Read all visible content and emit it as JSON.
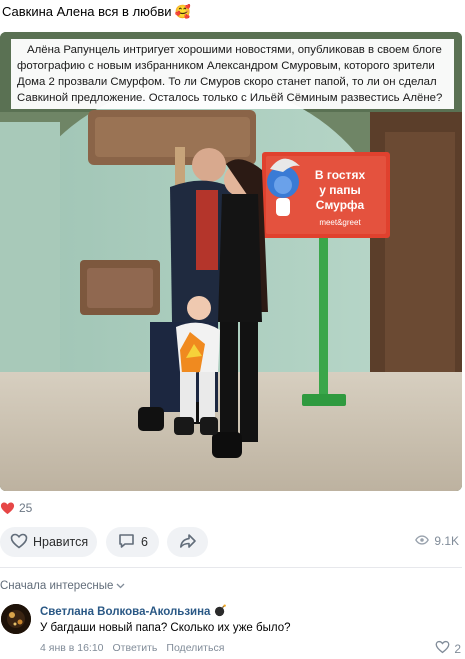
{
  "post": {
    "header_text": "Савкина Алена вся в любви",
    "header_emoji": "🥰",
    "caption": "Алёна Рапунцель интригует хорошими новостями, опубликовав в своем блоге фотографию с новым избранником Александром Смуровым, которого зрители Дома 2 прозвали Смурфом. То ли Смуров скоро станет папой, то ли он сделал Савкиной предложение. Осталось только с Ильёй Сёминым развестись Алёне?",
    "sign": {
      "line1": "В гостях",
      "line2": "у папы",
      "line3": "Смурфа",
      "line4": "meet&greet"
    },
    "likes_count": "25",
    "like_label": "Нравится",
    "comments_count": "6",
    "views": "9.1K"
  },
  "comments": {
    "sort_label": "Сначала интересные",
    "items": [
      {
        "author": "Светлана Волкова-Акользина",
        "text": "У багдаши новый папа? Сколько их уже было?",
        "date": "4 янв в 16:10",
        "reply_label": "Ответить",
        "share_label": "Поделиться",
        "likes": "2"
      }
    ]
  },
  "colors": {
    "accent_red": "#e64646",
    "link_blue": "#2a5885",
    "sign_red": "#e0412e",
    "sign_pole_green": "#3aa64a"
  },
  "icons": [
    "heart-icon",
    "like-outline-icon",
    "comment-icon",
    "share-icon",
    "eye-icon",
    "chevron-down-icon",
    "bomb-icon"
  ]
}
